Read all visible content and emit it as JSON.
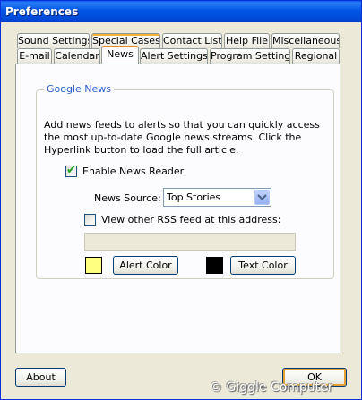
{
  "window": {
    "title": "Preferences"
  },
  "tabs_row1": [
    {
      "label": "Sound Settings"
    },
    {
      "label": "Special Cases"
    },
    {
      "label": "Contact List"
    },
    {
      "label": "Help File"
    },
    {
      "label": "Miscellaneous"
    }
  ],
  "tabs_row2": [
    {
      "label": "E-mail"
    },
    {
      "label": "Calendar"
    },
    {
      "label": "News",
      "selected": true
    },
    {
      "label": "Alert Settings"
    },
    {
      "label": "Program Settings"
    },
    {
      "label": "Regional"
    }
  ],
  "group": {
    "title": "Google News",
    "description": "Add news feeds to alerts so that you can quickly access the most up-to-date Google news streams. Click the Hyperlink button to load the full article.",
    "enable_reader": {
      "label": "Enable News Reader",
      "checked": true
    },
    "news_source": {
      "label": "News Source:",
      "value": "Top Stories"
    },
    "rss_option": {
      "label": "View other RSS feed at this address:",
      "checked": false
    },
    "rss_address": {
      "value": ""
    },
    "alert_color": {
      "label": "Alert Color",
      "color": "#ffff80"
    },
    "text_color": {
      "label": "Text Color",
      "color": "#000000"
    }
  },
  "footer": {
    "about_label": "About",
    "ok_label": "OK"
  },
  "watermark": "© Giggle Computer"
}
